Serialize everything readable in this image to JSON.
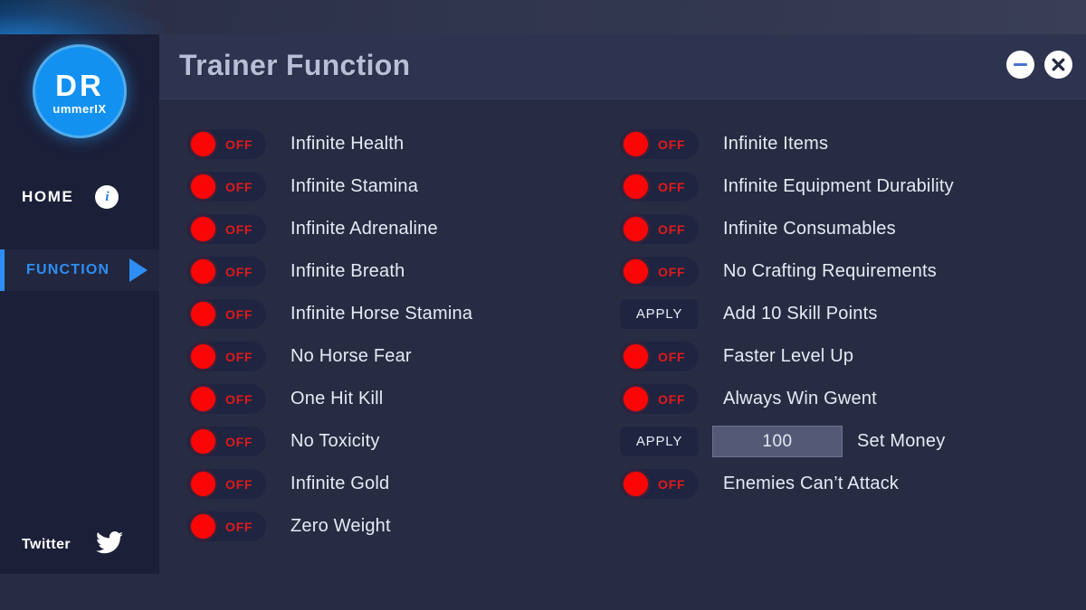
{
  "window": {
    "title": "Trainer Function",
    "minimize_icon": "minimize-icon",
    "close_icon": "close-icon"
  },
  "sidebar": {
    "logo": {
      "main": "DR",
      "sub": "ummerIX"
    },
    "nav": [
      {
        "label": "HOME",
        "icon": "info-icon",
        "active": false
      },
      {
        "label": "FUNCTION",
        "icon": "play-triangle-icon",
        "active": true
      }
    ],
    "footer": {
      "label": "Twitter",
      "icon": "twitter-bird-icon"
    }
  },
  "labels": {
    "off": "OFF",
    "apply": "APPLY"
  },
  "colors": {
    "accent_blue": "#2f8ef5",
    "toggle_red": "#fb0606",
    "off_text_red": "#e01a1a",
    "panel_bg": "#272c42",
    "sidebar_bg": "#1b1f38",
    "titlebar_bg": "#2e3450",
    "title_text": "#b7bfd6",
    "input_bg": "#545a76"
  },
  "left_column": [
    {
      "type": "toggle",
      "state": "OFF",
      "label": "Infinite Health"
    },
    {
      "type": "toggle",
      "state": "OFF",
      "label": "Infinite Stamina"
    },
    {
      "type": "toggle",
      "state": "OFF",
      "label": "Infinite Adrenaline"
    },
    {
      "type": "toggle",
      "state": "OFF",
      "label": "Infinite Breath"
    },
    {
      "type": "toggle",
      "state": "OFF",
      "label": "Infinite Horse Stamina"
    },
    {
      "type": "toggle",
      "state": "OFF",
      "label": "No Horse Fear"
    },
    {
      "type": "toggle",
      "state": "OFF",
      "label": "One Hit Kill"
    },
    {
      "type": "toggle",
      "state": "OFF",
      "label": "No Toxicity"
    },
    {
      "type": "toggle",
      "state": "OFF",
      "label": "Infinite Gold"
    },
    {
      "type": "toggle",
      "state": "OFF",
      "label": "Zero Weight"
    }
  ],
  "right_column": [
    {
      "type": "toggle",
      "state": "OFF",
      "label": "Infinite Items"
    },
    {
      "type": "toggle",
      "state": "OFF",
      "label": "Infinite Equipment Durability"
    },
    {
      "type": "toggle",
      "state": "OFF",
      "label": "Infinite Consumables"
    },
    {
      "type": "toggle",
      "state": "OFF",
      "label": "No Crafting Requirements"
    },
    {
      "type": "apply",
      "button": "APPLY",
      "label": "Add 10 Skill Points"
    },
    {
      "type": "toggle",
      "state": "OFF",
      "label": "Faster Level Up"
    },
    {
      "type": "toggle",
      "state": "OFF",
      "label": "Always Win Gwent"
    },
    {
      "type": "apply_input",
      "button": "APPLY",
      "value": "100",
      "label": "Set Money"
    },
    {
      "type": "toggle",
      "state": "OFF",
      "label": "Enemies Can’t Attack"
    }
  ]
}
